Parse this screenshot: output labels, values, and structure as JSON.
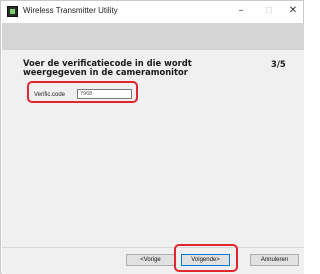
{
  "window": {
    "title": "Wireless Transmitter Utility",
    "minimize_glyph": "–",
    "maximize_glyph": "☐",
    "close_glyph": "✕"
  },
  "step": {
    "heading": "Voer de verificatiecode in die wordt weergegeven in de cameramonitor",
    "progress": "3/5"
  },
  "form": {
    "code_label": "Verific.code",
    "code_value": "7968"
  },
  "buttons": {
    "prev_label": "<Vorige",
    "next_label": "Volgende>",
    "cancel_label": "Annuleren"
  },
  "colors": {
    "highlight": "#e0262f",
    "banner": "#d5d5d5",
    "content_bg": "#f0f0f0"
  }
}
